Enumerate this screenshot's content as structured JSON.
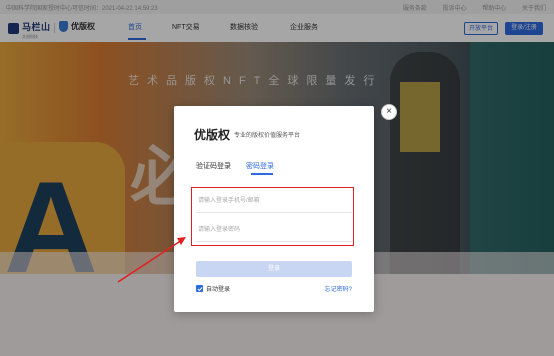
{
  "topbar": {
    "time_text": "中国科学院国家授时中心可信时间：2021-04-22 14:59:23",
    "links": [
      "服务条款",
      "投诉中心",
      "帮助中心",
      "关于我们"
    ]
  },
  "navbar": {
    "logo_main": "马栏山",
    "logo_sub": "文创科技",
    "logo2": "优版权",
    "items": [
      "首页",
      "NFT交易",
      "数据核验",
      "企业服务"
    ],
    "open_platform": "开放平台",
    "login_register": "登录/注册"
  },
  "hero": {
    "slogan": "艺术品版权NFT全球限量发行",
    "big_text": "必      经"
  },
  "modal": {
    "title": "优版权",
    "subtitle": "专业的版权价值服务平台",
    "tabs": [
      "验证码登录",
      "密码登录"
    ],
    "active_tab": "密码登录",
    "account_placeholder": "请输入登录手机号/邮箱",
    "password_placeholder": "请输入登录密码",
    "login_button": "登录",
    "auto_login": "自动登录",
    "forgot": "忘记密码?",
    "close_icon": "close-icon"
  },
  "colors": {
    "accent": "#2d6be0",
    "annotation": "#e02020"
  }
}
